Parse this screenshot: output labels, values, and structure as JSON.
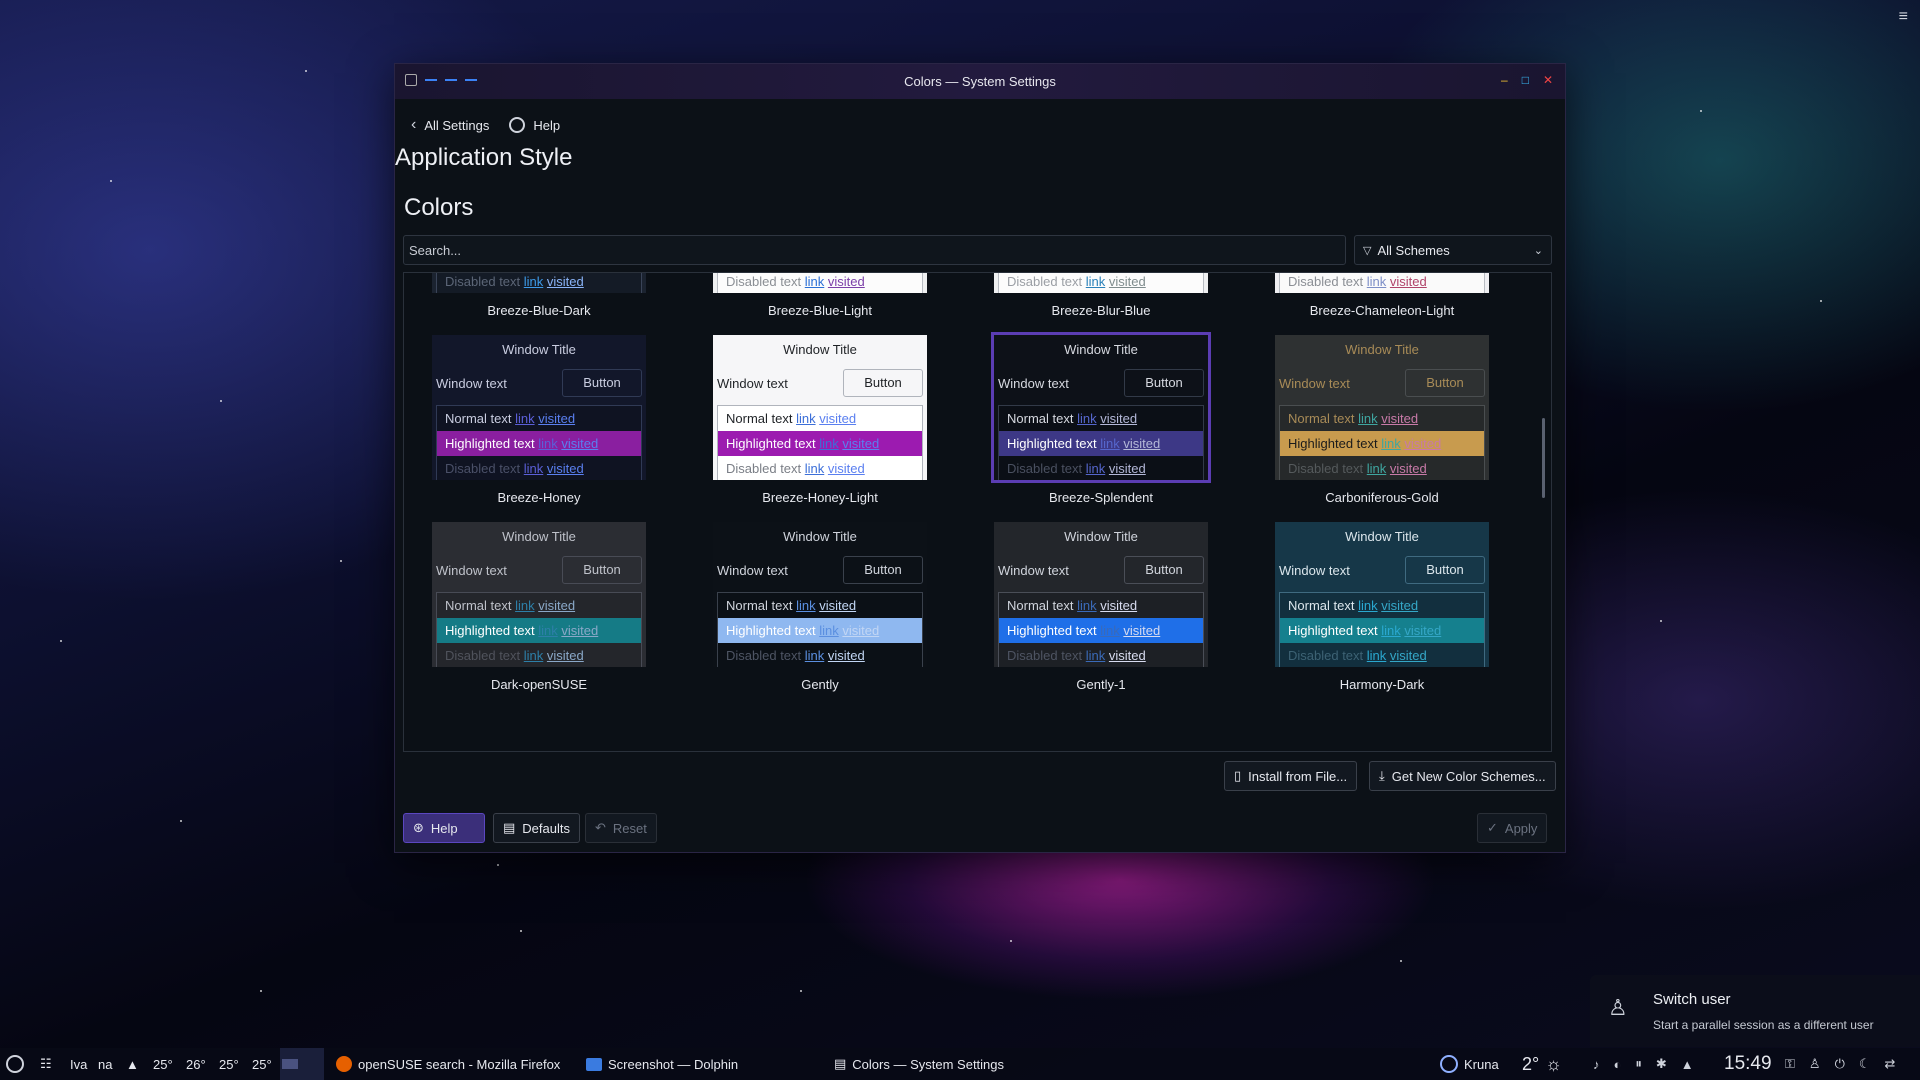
{
  "window": {
    "title": "Colors — System Settings",
    "back_label": "All Settings",
    "help_label": "Help",
    "page_title": "Application Style",
    "section_title": "Colors",
    "search_placeholder": "Search...",
    "filter_label": "All Schemes",
    "install_label": "Install from File...",
    "get_new_label": "Get New Color Schemes...",
    "bottom_help": "Help",
    "defaults": "Defaults",
    "reset": "Reset",
    "apply": "Apply"
  },
  "preview_text": {
    "window_title": "Window Title",
    "window_text": "Window text",
    "button": "Button",
    "normal": "Normal text",
    "highlighted": "Highlighted text",
    "disabled": "Disabled text",
    "link": "link",
    "visited": "visited"
  },
  "schemes": [
    {
      "name": "Breeze-Blue-Dark",
      "partial": true,
      "bg": "#1b2330",
      "listbg": "#141b26",
      "border": "#3a4458",
      "fg": "#dfe3ea",
      "hl": "#2a78c9",
      "hlfg": "#ffffff",
      "link": "#3d9be9",
      "visited": "#8ab4f8",
      "dis": "#5c6677",
      "btnbg": "#1b2330"
    },
    {
      "name": "Breeze-Blue-Light",
      "partial": true,
      "bg": "#eff0f1",
      "listbg": "#fcfcfc",
      "border": "#b8bcc2",
      "fg": "#232629",
      "hl": "#3b7fd0",
      "hlfg": "#ffffff",
      "link": "#2a6fd6",
      "visited": "#7b3fa8",
      "dis": "#8a8e94",
      "btnbg": "#eff0f1"
    },
    {
      "name": "Breeze-Blur-Blue",
      "partial": true,
      "bg": "#eff0f1",
      "listbg": "#fcfcfc",
      "border": "#b8bcc2",
      "fg": "#232629",
      "hl": "#3daee9",
      "hlfg": "#ffffff",
      "link": "#2980b9",
      "visited": "#7f8c8d",
      "dis": "#9a9ea4",
      "btnbg": "#eff0f1"
    },
    {
      "name": "Breeze-Chameleon-Light",
      "partial": true,
      "bg": "#efeff2",
      "listbg": "#fafafa",
      "border": "#b8bcc2",
      "fg": "#232629",
      "hl": "#a39ae8",
      "hlfg": "#232629",
      "link": "#7c8ec6",
      "visited": "#b0446a",
      "dis": "#8a8e94",
      "btnbg": "#efeff2"
    },
    {
      "name": "Breeze-Honey",
      "partial": false,
      "bg": "#12172a",
      "listbg": "#0f1322",
      "border": "#303a55",
      "fg": "#c9cde0",
      "hl": "#8a1fa0",
      "hlfg": "#ffffff",
      "link": "#5b5fd8",
      "visited": "#5a7ff0",
      "dis": "#4a5068",
      "btnbg": "#12172a"
    },
    {
      "name": "Breeze-Honey-Light",
      "partial": false,
      "bg": "#f6f6f8",
      "listbg": "#ffffff",
      "border": "#b0b4bc",
      "fg": "#1f2226",
      "hl": "#9c1bb0",
      "hlfg": "#ffffff",
      "link": "#3c6fd8",
      "visited": "#5a7ff0",
      "dis": "#7a7e86",
      "btnbg": "#f6f6f8"
    },
    {
      "name": "Breeze-Splendent",
      "partial": false,
      "selected": true,
      "bg": "#0d1118",
      "listbg": "#0b0f16",
      "border": "#323a48",
      "fg": "#d6d9e0",
      "hl": "#3d3886",
      "hlfg": "#ffffff",
      "link": "#5566cc",
      "visited": "#b4b8d8",
      "dis": "#4a5060",
      "btnbg": "#0d1118"
    },
    {
      "name": "Carboniferous-Gold",
      "partial": false,
      "bg": "#2e3132",
      "listbg": "#26292a",
      "border": "#4a4e50",
      "fg": "#a88b57",
      "hl": "#c89b4e",
      "hlfg": "#1b1b1b",
      "link": "#3fa6a0",
      "visited": "#c87aa8",
      "dis": "#555a5c",
      "btnbg": "#2e3132"
    },
    {
      "name": "Dark-openSUSE",
      "partial": false,
      "bg": "#2b2d33",
      "listbg": "#24262b",
      "border": "#484b55",
      "fg": "#bfc2ca",
      "hl": "#157b86",
      "hlfg": "#ffffff",
      "link": "#2d7fa8",
      "visited": "#8aa8c8",
      "dis": "#50535c",
      "btnbg": "#2b2d33"
    },
    {
      "name": "Gently",
      "partial": false,
      "bg": "#0c1117",
      "listbg": "#0b1016",
      "border": "#3a414c",
      "fg": "#d0d4dc",
      "hl": "#8fb8f0",
      "hlfg": "#ffffff",
      "link": "#5b8fe0",
      "visited": "#c2d6f4",
      "dis": "#4e5564",
      "btnbg": "#0c1117"
    },
    {
      "name": "Gently-1",
      "partial": false,
      "bg": "#23262b",
      "listbg": "#1d2025",
      "border": "#4a4e57",
      "fg": "#d0d4dc",
      "hl": "#1f6fe8",
      "hlfg": "#ffffff",
      "link": "#3a6ab8",
      "visited": "#d8dcf0",
      "dis": "#4e5462",
      "btnbg": "#23262b"
    },
    {
      "name": "Harmony-Dark",
      "partial": false,
      "bg": "#163748",
      "listbg": "#122f3e",
      "border": "#3f6a80",
      "fg": "#dbe6ec",
      "hl": "#15808e",
      "hlfg": "#ffffff",
      "link": "#2aa8d0",
      "visited": "#35a7c7",
      "dis": "#3d6274",
      "btnbg": "#163748"
    }
  ],
  "taskbar": {
    "items_left": [
      "Iva",
      "na"
    ],
    "temps": [
      "25°",
      "26°",
      "25°",
      "25°"
    ],
    "tasks": [
      "openSUSE search - Mozilla Firefox",
      "Screenshot — Dolphin",
      "Colors — System Settings"
    ],
    "kruna": "Kruna",
    "weather": "2°",
    "clock": "15:49"
  },
  "notification": {
    "title": "Switch user",
    "subtitle": "Start a parallel session as a different user"
  }
}
